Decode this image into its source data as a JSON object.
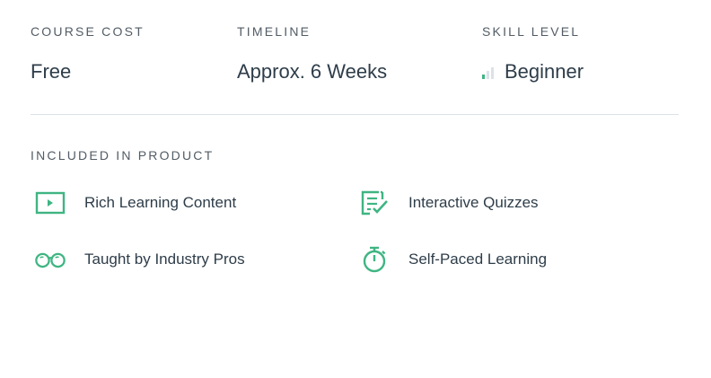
{
  "stats": {
    "course_cost": {
      "label": "COURSE COST",
      "value": "Free"
    },
    "timeline": {
      "label": "TIMELINE",
      "value": "Approx. 6 Weeks"
    },
    "skill_level": {
      "label": "SKILL LEVEL",
      "value": "Beginner",
      "level": 1,
      "max_level": 3
    }
  },
  "included": {
    "title": "INCLUDED IN PRODUCT",
    "items": [
      {
        "label": "Rich Learning Content",
        "icon": "video-play-icon"
      },
      {
        "label": "Interactive Quizzes",
        "icon": "quiz-checklist-icon"
      },
      {
        "label": "Taught by Industry Pros",
        "icon": "glasses-icon"
      },
      {
        "label": "Self-Paced Learning",
        "icon": "stopwatch-icon"
      }
    ]
  },
  "colors": {
    "accent": "#3fb582",
    "text": "#2e3d49",
    "label": "#525c65",
    "divider": "#dbe2e8"
  }
}
